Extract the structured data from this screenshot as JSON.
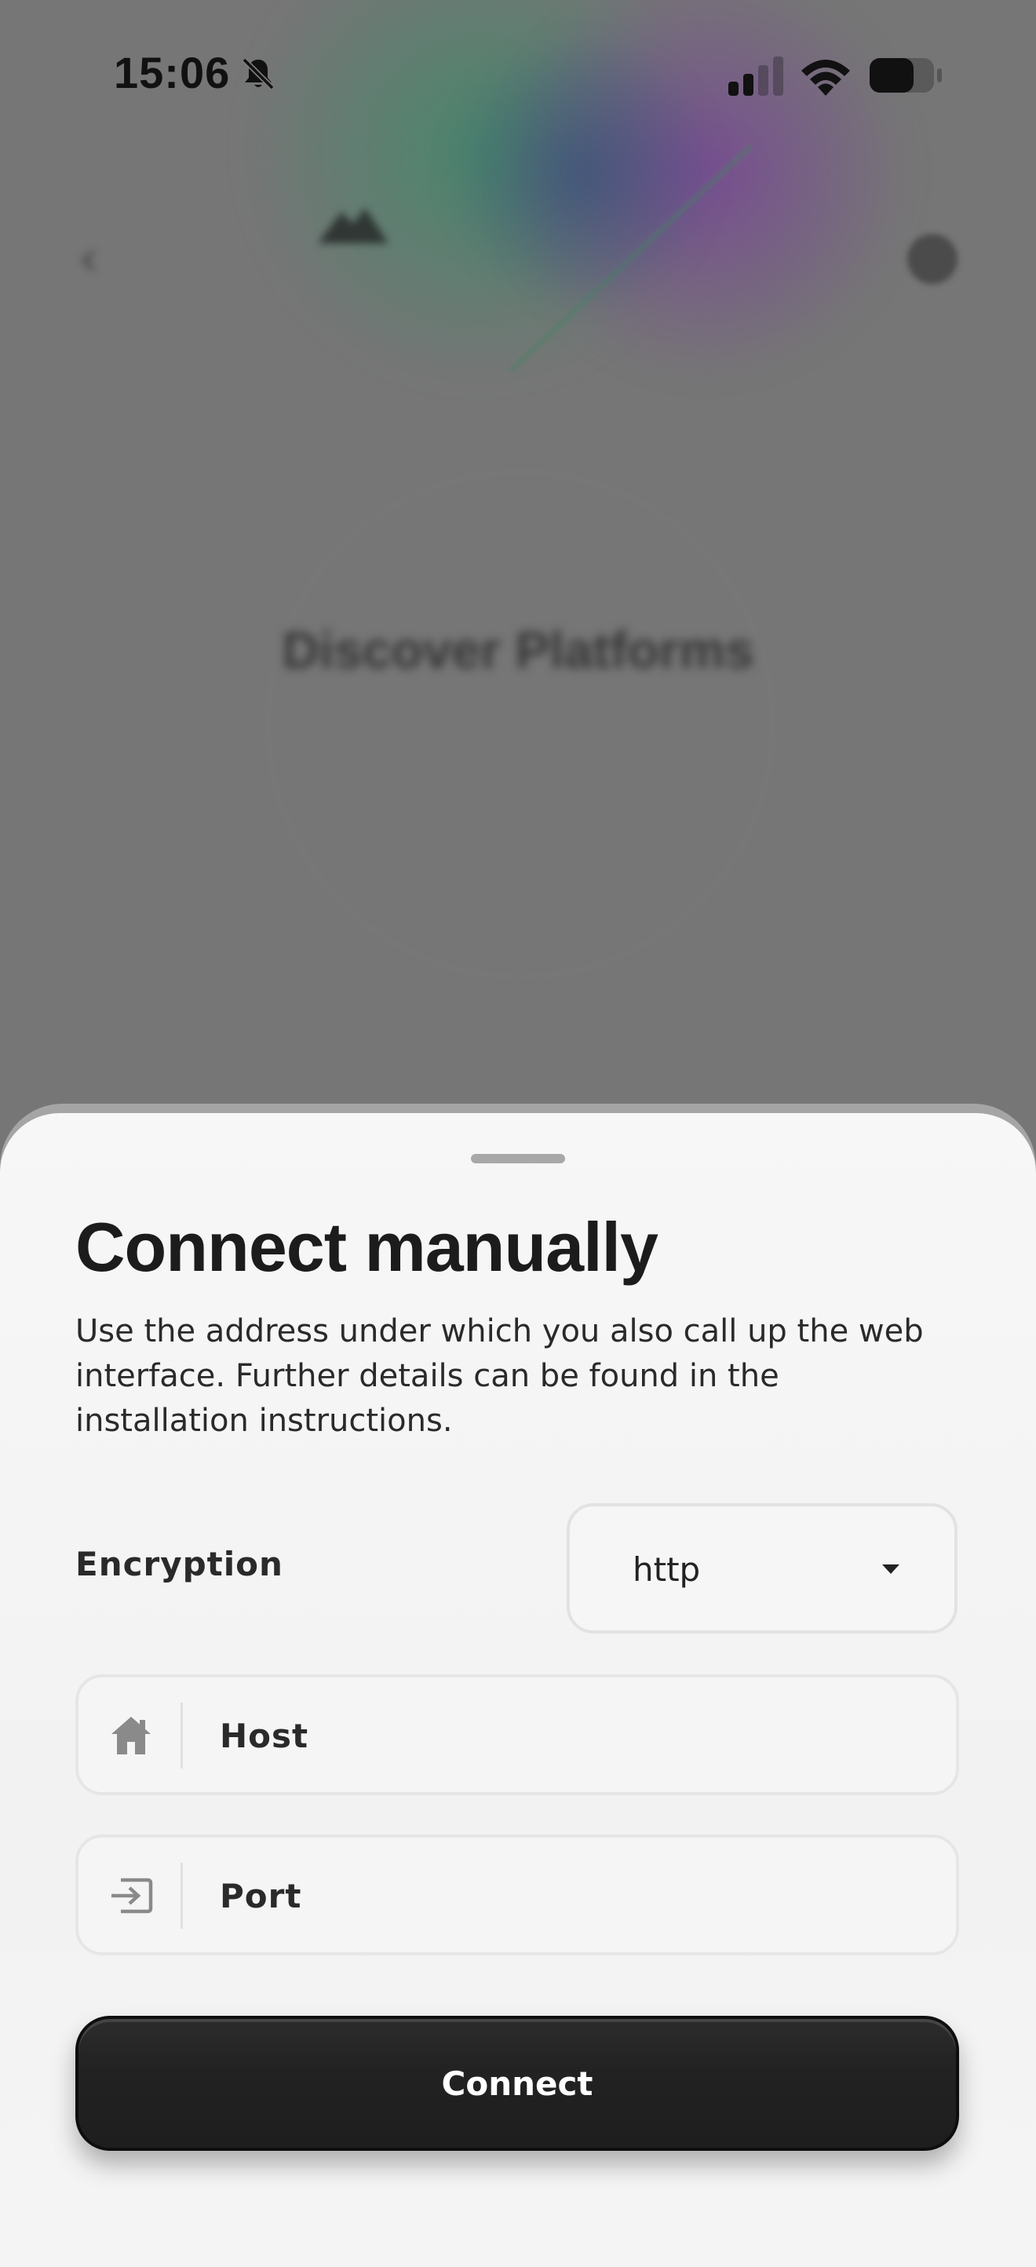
{
  "status_bar": {
    "time": "15:06",
    "icons": [
      "bell-muted-icon",
      "cellular-signal-icon",
      "wifi-icon",
      "battery-icon"
    ]
  },
  "background": {
    "title": "Discover Platforms"
  },
  "sheet": {
    "title": "Connect manually",
    "description": "Use the address under which you also call up the web interface. Further details can be found in the installation instructions.",
    "encryption": {
      "label": "Encryption",
      "selected": "http"
    },
    "host_field": {
      "placeholder": "Host",
      "value": "",
      "icon": "home-icon"
    },
    "port_field": {
      "placeholder": "Port",
      "value": "",
      "icon": "login-arrow-icon"
    },
    "connect_label": "Connect"
  },
  "colors": {
    "sheet_background": "#f4f4f4",
    "button_background": "#222222",
    "button_text": "#ffffff",
    "text_primary": "#1c1c1c",
    "field_border": "#e4e4e4",
    "icon_gray": "#8a8a8a"
  }
}
